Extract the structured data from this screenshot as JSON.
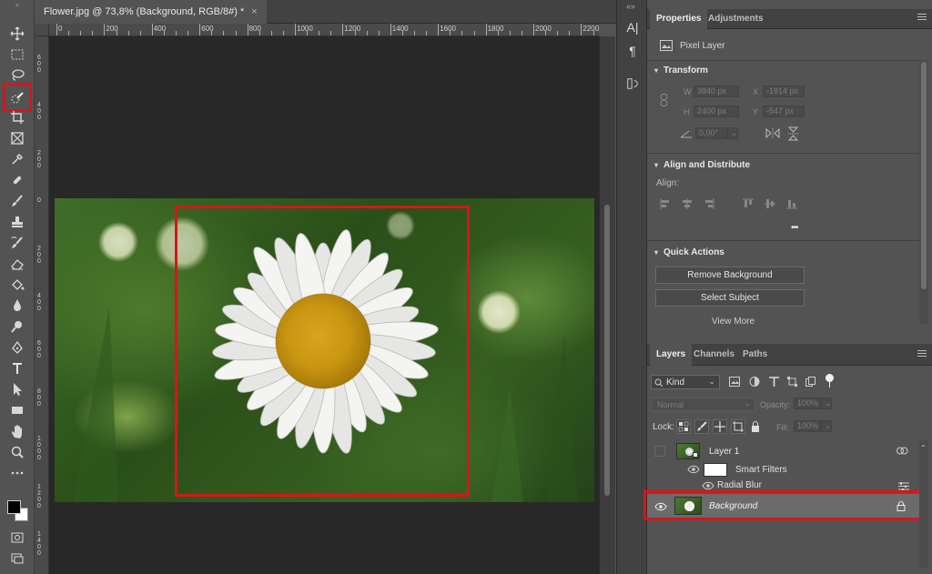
{
  "document": {
    "tab_title": "Flower.jpg @ 73,8% (Background, RGB/8#) *",
    "close_glyph": "×",
    "ruler_h": [
      "0",
      "200",
      "400",
      "600",
      "800",
      "1000",
      "1200",
      "1400",
      "1600",
      "1800",
      "2000",
      "2200"
    ],
    "ruler_v": [
      "600",
      "400",
      "200",
      "0",
      "200",
      "400",
      "600",
      "800",
      "1000",
      "1200",
      "1400"
    ]
  },
  "colors": {
    "highlight": "#d9141a",
    "panel_bg": "#535353",
    "canvas_bg": "#282828"
  },
  "toolbar": {
    "tools": [
      "move-icon",
      "marquee-icon",
      "lasso-icon",
      "quick-selection-icon",
      "crop-icon",
      "frame-icon",
      "eyedropper-icon",
      "healing-brush-icon",
      "brush-icon",
      "clone-stamp-icon",
      "history-brush-icon",
      "eraser-icon",
      "paint-bucket-icon",
      "blur-icon",
      "dodge-icon",
      "pen-icon",
      "type-icon",
      "path-selection-icon",
      "rectangle-icon",
      "hand-icon",
      "zoom-icon",
      "more-tools-icon"
    ],
    "highlighted_tool": "quick-selection-icon"
  },
  "properties": {
    "tabs": [
      "Properties",
      "Adjustments"
    ],
    "layer_kind": "Pixel Layer",
    "transform": {
      "title": "Transform",
      "w_label": "W",
      "w": "3840 px",
      "h_label": "H",
      "h": "2400 px",
      "x_label": "X",
      "x": "-1914 px",
      "y_label": "Y",
      "y": "-547 px",
      "angle": "0,00°"
    },
    "align": {
      "title": "Align and Distribute",
      "label": "Align:",
      "more": "•••"
    },
    "quick_actions": {
      "title": "Quick Actions",
      "remove_bg": "Remove Background",
      "select_subject": "Select Subject",
      "view_more": "View More"
    }
  },
  "layers": {
    "tabs": [
      "Layers",
      "Channels",
      "Paths"
    ],
    "filter_kind": "Kind",
    "blend_mode": "Normal",
    "opacity_label": "Opacity:",
    "opacity": "100%",
    "lock_label": "Lock:",
    "fill_label": "Fill:",
    "fill": "100%",
    "items": [
      {
        "name": "Layer 1"
      },
      {
        "name": "Smart Filters"
      },
      {
        "name": "Radial Blur"
      },
      {
        "name": "Background"
      }
    ]
  }
}
